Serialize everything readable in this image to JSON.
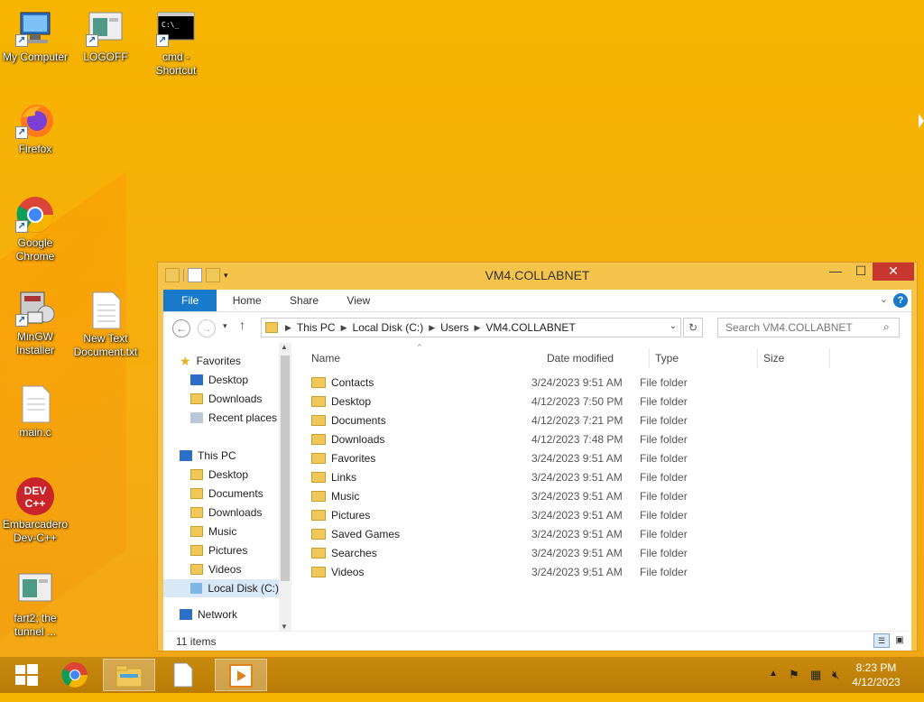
{
  "desktop": {
    "icons": [
      {
        "label": "My Computer",
        "icon": "computer-icon"
      },
      {
        "label": "LOGOFF",
        "icon": "window-icon"
      },
      {
        "label": "cmd - Shortcut",
        "icon": "cmd-icon"
      },
      {
        "label": "Firefox",
        "icon": "firefox-icon"
      },
      {
        "label": "Google Chrome",
        "icon": "chrome-icon"
      },
      {
        "label": "MinGW Installer",
        "icon": "installer-icon"
      },
      {
        "label": "New Text Document.txt",
        "icon": "text-file-icon"
      },
      {
        "label": "main.c",
        "icon": "text-file-icon"
      },
      {
        "label": "Embarcadero Dev-C++",
        "icon": "devcpp-icon"
      },
      {
        "label": "fart2; the tunnel ...",
        "icon": "window-icon"
      }
    ],
    "devcpp_logo": "DEV C++"
  },
  "window": {
    "title": "VM4.COLLABNET",
    "controls": {
      "minimize": "—",
      "maximize": "☐",
      "close": "✕"
    },
    "ribbon_tabs": [
      "File",
      "Home",
      "Share",
      "View"
    ],
    "help": "?",
    "breadcrumb": [
      "This PC",
      "Local Disk (C:)",
      "Users",
      "VM4.COLLABNET"
    ],
    "search_placeholder": "Search VM4.COLLABNET",
    "nav": {
      "favorites_header": "Favorites",
      "favorites": [
        "Desktop",
        "Downloads",
        "Recent places"
      ],
      "thispc_header": "This PC",
      "thispc": [
        "Desktop",
        "Documents",
        "Downloads",
        "Music",
        "Pictures",
        "Videos",
        "Local Disk (C:)"
      ],
      "network": "Network"
    },
    "columns": [
      "Name",
      "Date modified",
      "Type",
      "Size"
    ],
    "rows": [
      {
        "name": "Contacts",
        "date": "3/24/2023 9:51 AM",
        "type": "File folder"
      },
      {
        "name": "Desktop",
        "date": "4/12/2023 7:50 PM",
        "type": "File folder"
      },
      {
        "name": "Documents",
        "date": "4/12/2023 7:21 PM",
        "type": "File folder"
      },
      {
        "name": "Downloads",
        "date": "4/12/2023 7:48 PM",
        "type": "File folder"
      },
      {
        "name": "Favorites",
        "date": "3/24/2023 9:51 AM",
        "type": "File folder"
      },
      {
        "name": "Links",
        "date": "3/24/2023 9:51 AM",
        "type": "File folder"
      },
      {
        "name": "Music",
        "date": "3/24/2023 9:51 AM",
        "type": "File folder"
      },
      {
        "name": "Pictures",
        "date": "3/24/2023 9:51 AM",
        "type": "File folder"
      },
      {
        "name": "Saved Games",
        "date": "3/24/2023 9:51 AM",
        "type": "File folder"
      },
      {
        "name": "Searches",
        "date": "3/24/2023 9:51 AM",
        "type": "File folder"
      },
      {
        "name": "Videos",
        "date": "3/24/2023 9:51 AM",
        "type": "File folder"
      }
    ],
    "status": "11 items"
  },
  "taskbar": {
    "time": "8:23 PM",
    "date": "4/12/2023"
  },
  "colors": {
    "accent": "#1979ca",
    "close": "#c7372f",
    "desktop": "#f7b400"
  }
}
